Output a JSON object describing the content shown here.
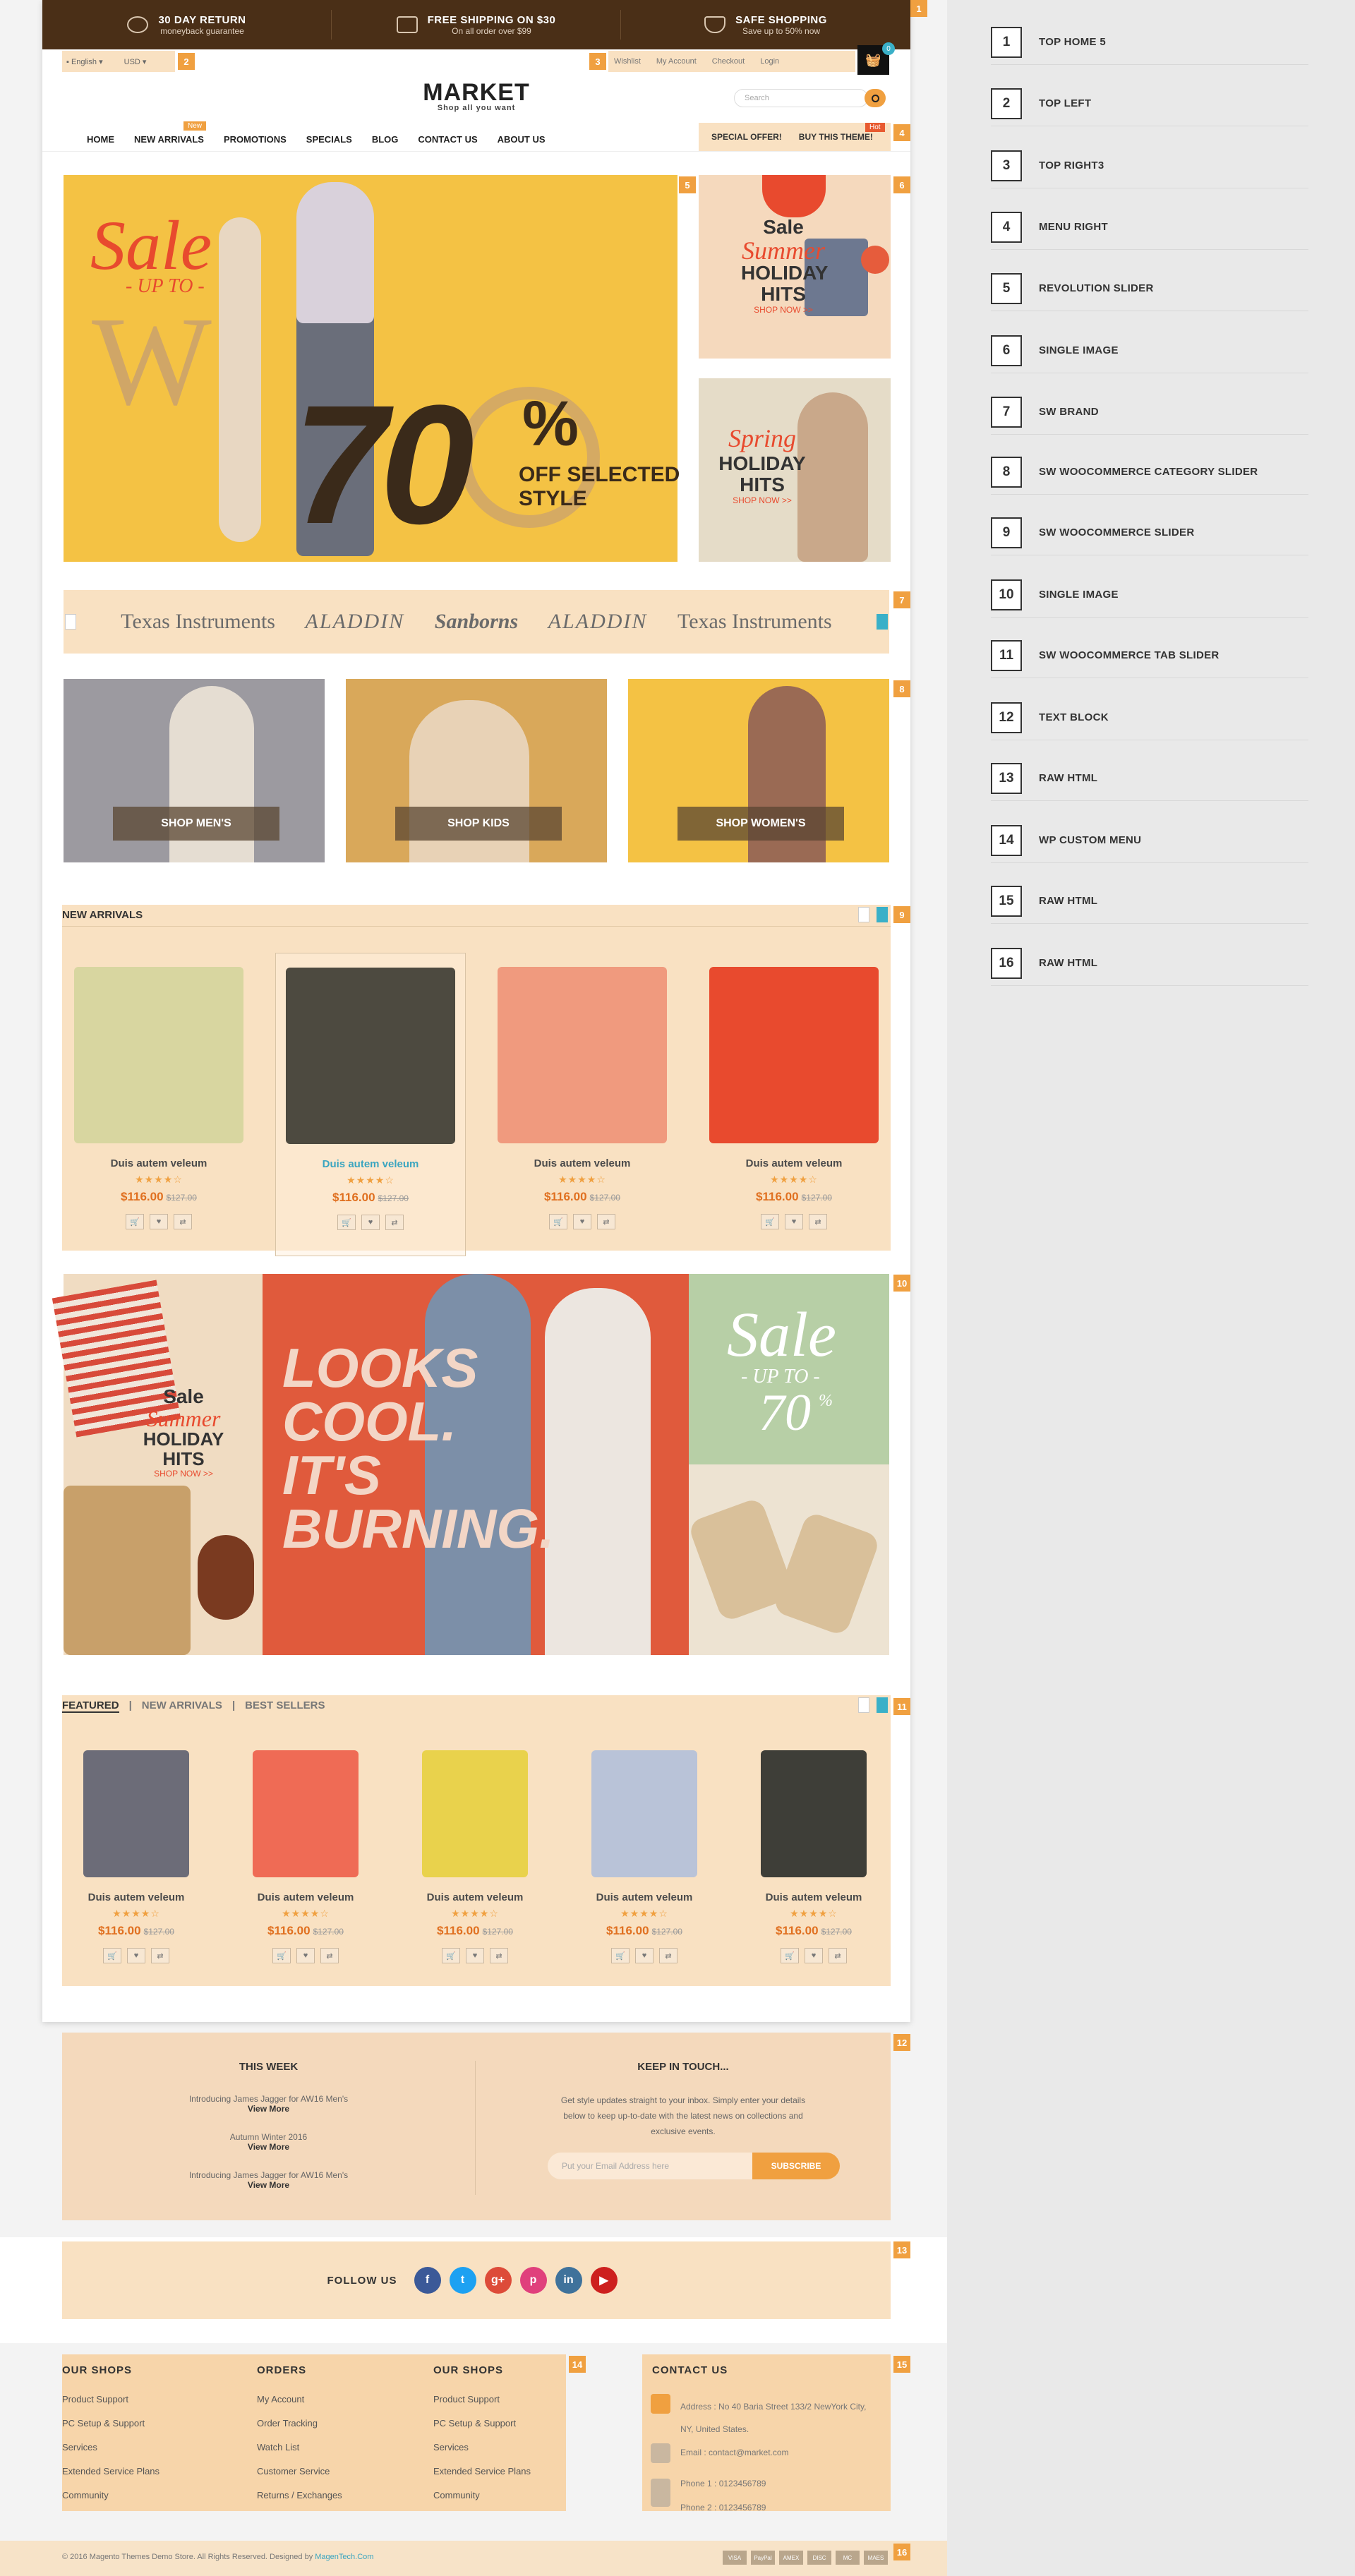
{
  "topbar": {
    "items": [
      {
        "title": "30 DAY RETURN",
        "sub": "moneyback guarantee",
        "icon": "clock-icon"
      },
      {
        "title": "FREE SHIPPING ON $30",
        "sub": "On all order over $99",
        "icon": "truck-icon"
      },
      {
        "title": "SAFE SHOPPING",
        "sub": "Save up to 50% now",
        "icon": "shield-icon"
      }
    ]
  },
  "topleft": {
    "language": "English",
    "currency": "USD"
  },
  "topright": {
    "links": [
      "Wishlist",
      "My Account",
      "Checkout",
      "Login"
    ],
    "cart_count": "0"
  },
  "logo": {
    "title": "MARKET",
    "tagline": "Shop all you want"
  },
  "search": {
    "placeholder": "Search"
  },
  "nav": {
    "items": [
      "HOME",
      "NEW ARRIVALS",
      "PROMOTIONS",
      "SPECIALS",
      "BLOG",
      "CONTACT US",
      "ABOUT US"
    ],
    "new_badge": "New",
    "hot_badge": "Hot",
    "menu_right": [
      "SPECIAL OFFER!",
      "BUY THIS THEME!"
    ]
  },
  "slider": {
    "sale": "Sale",
    "upto": "- UP TO -",
    "percent": "70",
    "percent_sign": "%",
    "off_line1": "OFF SELECTED",
    "off_line2": "STYLE"
  },
  "side_banner1": {
    "sale": "Sale",
    "season": "Summer",
    "line1": "HOLIDAY",
    "line2": "HITS",
    "cta": "SHOP NOW >>"
  },
  "side_banner2": {
    "season": "Spring",
    "line1": "HOLIDAY",
    "line2": "HITS",
    "cta": "SHOP NOW >>"
  },
  "brands": [
    "Texas Instruments",
    "ALADDIN",
    "Sanborns",
    "ALADDIN",
    "Texas Instruments"
  ],
  "categories": [
    "SHOP MEN'S",
    "SHOP KIDS",
    "SHOP WOMEN'S"
  ],
  "new_arrivals": {
    "title": "NEW ARRIVALS",
    "products": [
      {
        "name": "Duis autem veleum",
        "stars": "★★★★☆",
        "price": "$116.00",
        "old": "$127.00",
        "color": "#d8d6a0"
      },
      {
        "name": "Duis autem veleum",
        "stars": "★★★★☆",
        "price": "$116.00",
        "old": "$127.00",
        "color": "#4d4a40"
      },
      {
        "name": "Duis autem veleum",
        "stars": "★★★★☆",
        "price": "$116.00",
        "old": "$127.00",
        "color": "#f09a7e"
      },
      {
        "name": "Duis autem veleum",
        "stars": "★★★★☆",
        "price": "$116.00",
        "old": "$127.00",
        "color": "#e84a2e"
      }
    ]
  },
  "mid_banner": {
    "left": {
      "sale": "Sale",
      "season": "Summer",
      "line1": "HOLIDAY",
      "line2": "HITS",
      "cta": "SHOP NOW >>"
    },
    "center": {
      "line1": "LOOKS",
      "line2": "COOL.",
      "line3": "IT'S",
      "line4": "BURNING."
    },
    "right": {
      "sale": "Sale",
      "upto": "- UP TO -",
      "percent": "70",
      "percent_sign": "%"
    }
  },
  "tab_slider": {
    "tabs": [
      "FEATURED",
      "NEW ARRIVALS",
      "BEST SELLERS"
    ],
    "products": [
      {
        "name": "Duis autem veleum",
        "stars": "★★★★☆",
        "price": "$116.00",
        "old": "$127.00",
        "color": "#6c6c78"
      },
      {
        "name": "Duis autem veleum",
        "stars": "★★★★☆",
        "price": "$116.00",
        "old": "$127.00",
        "color": "#ef6b55"
      },
      {
        "name": "Duis autem veleum",
        "stars": "★★★★☆",
        "price": "$116.00",
        "old": "$127.00",
        "color": "#e9d24c"
      },
      {
        "name": "Duis autem veleum",
        "stars": "★★★★☆",
        "price": "$116.00",
        "old": "$127.00",
        "color": "#b9c3d8"
      },
      {
        "name": "Duis autem veleum",
        "stars": "★★★★☆",
        "price": "$116.00",
        "old": "$127.00",
        "color": "#3e3e38"
      }
    ]
  },
  "text_block": {
    "this_week": "THIS WEEK",
    "items": [
      {
        "text": "Introducing James Jagger for AW16 Men's",
        "more": "View More"
      },
      {
        "text": "Autumn Winter 2016",
        "more": "View More"
      },
      {
        "text": "Introducing James Jagger for AW16 Men's",
        "more": "View More"
      }
    ],
    "keep_title": "KEEP IN TOUCH...",
    "keep_text": "Get style updates straight to your inbox. Simply enter your details below to keep up-to-date with the latest news on collections and exclusive events.",
    "email_placeholder": "Put your Email Address here",
    "subscribe": "SUBSCRIBE"
  },
  "follow": {
    "label": "FOLLOW US",
    "icons": [
      {
        "g": "f",
        "c": "#3b5998"
      },
      {
        "g": "t",
        "c": "#1da1f2"
      },
      {
        "g": "g+",
        "c": "#dd4b39"
      },
      {
        "g": "p",
        "c": "#e0407c"
      },
      {
        "g": "in",
        "c": "#3f729b"
      },
      {
        "g": "▶",
        "c": "#cd201f"
      }
    ]
  },
  "footer_menu": {
    "cols": [
      {
        "title": "OUR SHOPS",
        "links": [
          "Product Support",
          "PC Setup & Support",
          "Services",
          "Extended Service Plans",
          "Community"
        ]
      },
      {
        "title": "ORDERS",
        "links": [
          "My Account",
          "Order Tracking",
          "Watch List",
          "Customer Service",
          "Returns / Exchanges"
        ]
      },
      {
        "title": "OUR SHOPS",
        "links": [
          "Product Support",
          "PC Setup & Support",
          "Services",
          "Extended Service Plans",
          "Community"
        ]
      }
    ]
  },
  "contact": {
    "title": "CONTACT US",
    "address1": "Address : No 40 Baria Street 133/2 NewYork City,",
    "address2": "NY, United States.",
    "email": "Email : contact@market.com",
    "phone1": "Phone 1 : 0123456789",
    "phone2": "Phone 2 : 0123456789"
  },
  "copyright": {
    "text": "© 2016 Magento Themes Demo Store. All Rights Reserved. Designed by",
    "link": "MagenTech.Com",
    "payments": [
      "VISA",
      "PayPal",
      "AMEX",
      "DISC",
      "MC",
      "MAES"
    ]
  },
  "legend": [
    {
      "num": "1",
      "label": "TOP HOME 5"
    },
    {
      "num": "2",
      "label": "TOP LEFT"
    },
    {
      "num": "3",
      "label": "TOP RIGHT3"
    },
    {
      "num": "4",
      "label": "MENU RIGHT"
    },
    {
      "num": "5",
      "label": "REVOLUTION SLIDER"
    },
    {
      "num": "6",
      "label": "SINGLE IMAGE"
    },
    {
      "num": "7",
      "label": "SW BRAND"
    },
    {
      "num": "8",
      "label": "SW WOOCOMMERCE CATEGORY SLIDER"
    },
    {
      "num": "9",
      "label": "SW WOOCOMMERCE SLIDER"
    },
    {
      "num": "10",
      "label": "SINGLE IMAGE"
    },
    {
      "num": "11",
      "label": "SW WOOCOMMERCE TAB SLIDER"
    },
    {
      "num": "12",
      "label": "TEXT BLOCK"
    },
    {
      "num": "13",
      "label": "RAW HTML"
    },
    {
      "num": "14",
      "label": "WP CUSTOM MENU"
    },
    {
      "num": "15",
      "label": "RAW HTML"
    },
    {
      "num": "16",
      "label": "RAW HTML"
    }
  ]
}
